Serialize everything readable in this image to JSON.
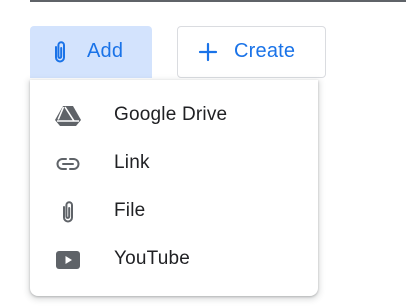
{
  "toolbar": {
    "add_label": "Add",
    "create_label": "Create"
  },
  "menu": {
    "items": [
      {
        "label": "Google Drive",
        "icon": "google-drive-icon"
      },
      {
        "label": "Link",
        "icon": "link-icon"
      },
      {
        "label": "File",
        "icon": "paperclip-icon"
      },
      {
        "label": "YouTube",
        "icon": "youtube-icon"
      }
    ]
  },
  "colors": {
    "accent": "#1a73e8",
    "add_button_bg": "#d3e3fd",
    "menu_text": "#202124",
    "menu_icon": "#5f6368",
    "border": "#dadce0"
  }
}
